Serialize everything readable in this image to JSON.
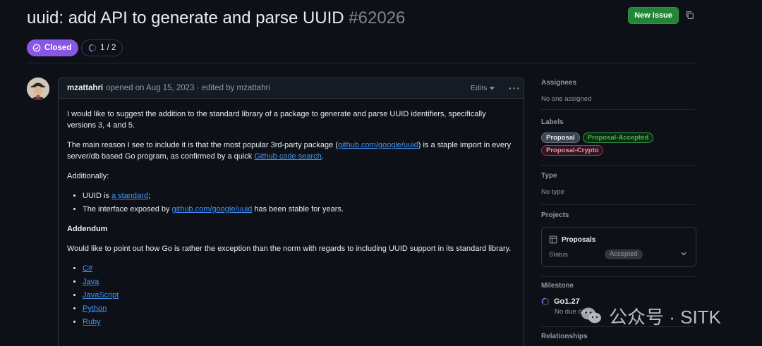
{
  "issue": {
    "title": "uuid: add API to generate and parse UUID",
    "number": "#62026",
    "state": "Closed",
    "subissues": "1 / 2",
    "new_issue_label": "New issue"
  },
  "comment": {
    "author": "mzattahri",
    "meta": "opened on Aug 15, 2023 · edited by mzattahri",
    "edits_label": "Edits",
    "body": {
      "p1": "I would like to suggest the addition to the standard library of a package to generate and parse UUID identifiers, specifically versions 3, 4 and 5.",
      "p2_pre": "The main reason I see to include it is that the most popular 3rd-party package (",
      "p2_link1": "github.com/google/uuid",
      "p2_mid": ") is a staple import in every server/db based Go program, as confirmed by a quick ",
      "p2_link2": "Github code search",
      "p2_post": ".",
      "p3": "Additionally:",
      "li1_pre": "UUID is ",
      "li1_link": "a standard",
      "li1_post": ";",
      "li2_pre": "The interface exposed by ",
      "li2_link": "github.com/google/uuid",
      "li2_post": " has been stable for years.",
      "addendum_heading": "Addendum",
      "p4": "Would like to point out how Go is rather the exception than the norm with regards to including UUID support in its standard library.",
      "languages": [
        "C#",
        "Java",
        "JavaScript",
        "Python",
        "Ruby"
      ]
    }
  },
  "sidebar": {
    "assignees": {
      "heading": "Assignees",
      "value": "No one assigned"
    },
    "labels": {
      "heading": "Labels",
      "items": [
        {
          "text": "Proposal",
          "color": "#e6edf3",
          "bg": "#3d444d",
          "border": "#6e7681"
        },
        {
          "text": "Proposal-Accepted",
          "color": "#3fb950",
          "bg": "#0f2a17",
          "border": "#2ea043"
        },
        {
          "text": "Proposal-Crypto",
          "color": "#f78fa7",
          "bg": "#2d1620",
          "border": "#8b3d55"
        }
      ]
    },
    "type": {
      "heading": "Type",
      "value": "No type"
    },
    "projects": {
      "heading": "Projects",
      "name": "Proposals",
      "status_label": "Status",
      "status_value": "Accepted"
    },
    "milestone": {
      "heading": "Milestone",
      "name": "Go1.27",
      "date": "No due date"
    },
    "relationships": {
      "heading": "Relationships"
    }
  },
  "watermark": {
    "text": "公众号 · SITK"
  },
  "colors": {
    "accent_green": "#238636",
    "closed_purple": "#8957e5",
    "link": "#4493f8"
  }
}
